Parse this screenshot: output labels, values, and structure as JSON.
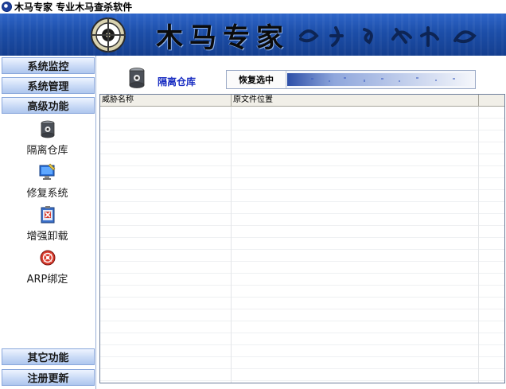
{
  "window": {
    "title": "木马专家  专业木马查杀软件"
  },
  "banner": {
    "title": "木马专家"
  },
  "sidebar": {
    "top_categories": [
      {
        "label": "系统监控"
      },
      {
        "label": "系统管理"
      },
      {
        "label": "高级功能"
      }
    ],
    "tools": [
      {
        "label": "隔离仓库",
        "icon": "quarantine-barrel-icon"
      },
      {
        "label": "修复系统",
        "icon": "monitor-repair-icon"
      },
      {
        "label": "增强卸载",
        "icon": "enhanced-uninstall-icon"
      },
      {
        "label": "ARP绑定",
        "icon": "arp-binding-icon"
      }
    ],
    "bottom_categories": [
      {
        "label": "其它功能"
      },
      {
        "label": "注册更新"
      }
    ]
  },
  "main": {
    "page_title": "隔离仓库",
    "page_icon": "quarantine-barrel-icon",
    "restore_button_label": "恢复选中",
    "table": {
      "columns": [
        "威胁名称",
        "原文件位置",
        ""
      ],
      "rows": []
    }
  },
  "colors": {
    "banner_blue": "#1c4ea8",
    "sidebar_button": "#c9daf6",
    "title_link_blue": "#1a2ec2"
  }
}
